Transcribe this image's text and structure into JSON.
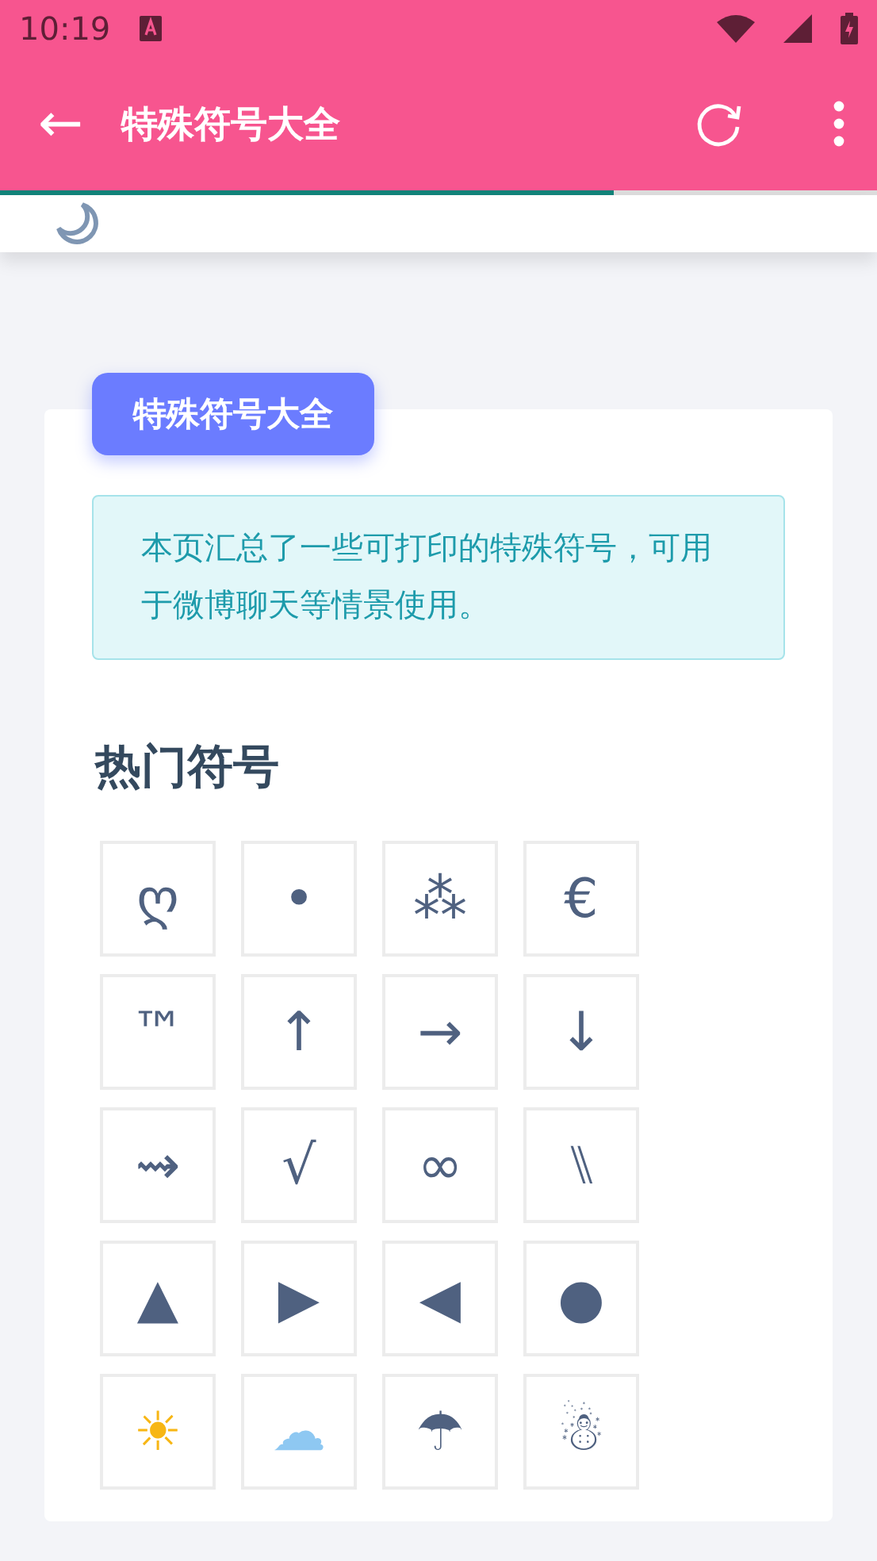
{
  "status_bar": {
    "time": "10:19"
  },
  "toolbar": {
    "back": "←",
    "title": "特殊符号大全"
  },
  "page_progress": {
    "level": 0.7
  },
  "content": {
    "badge": "特殊符号大全",
    "notice": "本页汇总了一些可打印的特殊符号，可用于微博聊天等情景使用。",
    "heading": "热门符号",
    "symbols": [
      {
        "symbol": "ღ"
      },
      {
        "symbol": "•"
      },
      {
        "symbol": "⁂"
      },
      {
        "symbol": "€"
      },
      {
        "symbol": "™"
      },
      {
        "symbol": "↑"
      },
      {
        "symbol": "→"
      },
      {
        "symbol": "↓"
      },
      {
        "symbol": "⇝"
      },
      {
        "symbol": "√"
      },
      {
        "symbol": "∞"
      },
      {
        "symbol": "⑊"
      },
      {
        "symbol": "▲"
      },
      {
        "symbol": "▶"
      },
      {
        "symbol": "◀"
      },
      {
        "symbol": "●"
      },
      {
        "symbol": "☀",
        "color": "#f7b614"
      },
      {
        "symbol": "☁",
        "color": "#8ec8f2"
      },
      {
        "symbol": "☂"
      },
      {
        "symbol": "☃"
      }
    ]
  }
}
